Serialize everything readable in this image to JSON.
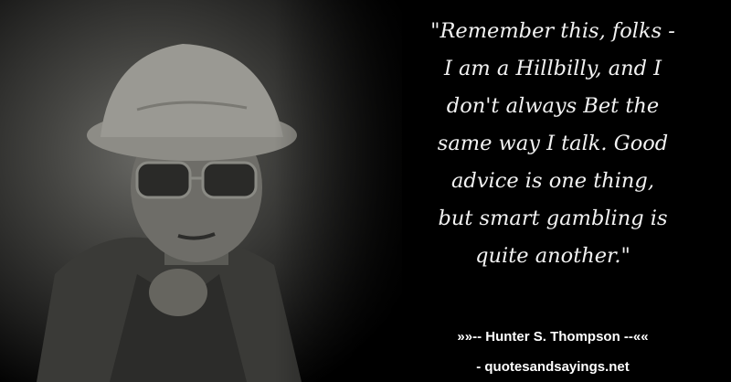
{
  "quote": {
    "lines": [
      "\"Remember this, folks -",
      "I am a Hillbilly, and I",
      "don't always Bet the",
      "same way I talk. Good",
      "advice is one thing,",
      "but smart gambling is",
      "quite another.\""
    ]
  },
  "attribution": {
    "author": "»»-- Hunter S. Thompson --««",
    "site": "- quotesandsayings.net"
  }
}
